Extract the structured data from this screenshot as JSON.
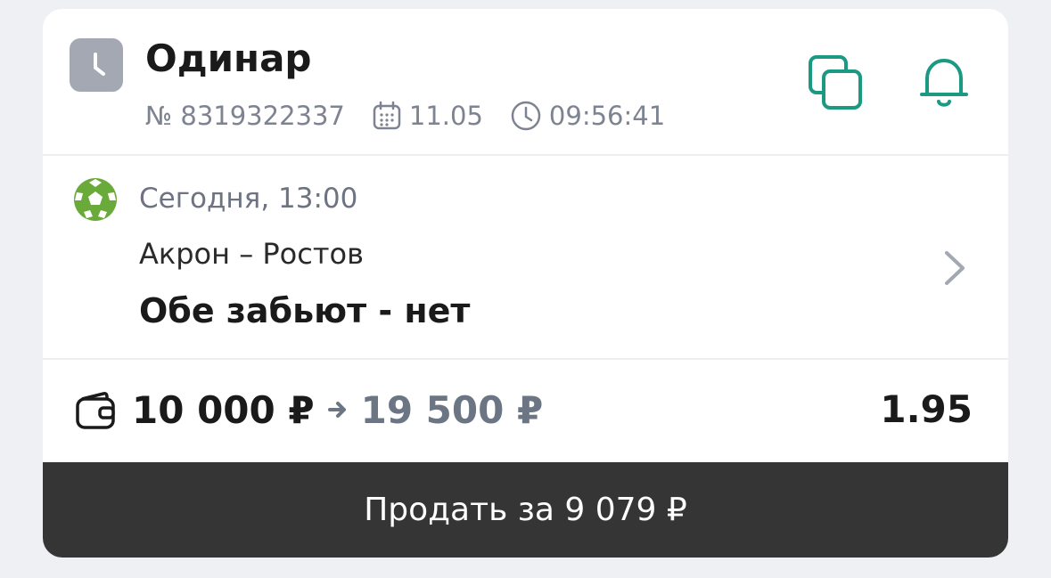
{
  "bet": {
    "type_label": "Одинар",
    "number": "№ 8319322337",
    "date": "11.05",
    "time": "09:56:41"
  },
  "event": {
    "sport_icon": "soccer-ball-icon",
    "start": "Сегодня, 13:00",
    "teams": "Акрон – Ростов",
    "selection": "Обе забьют - нет"
  },
  "amounts": {
    "stake": "10 000 ₽",
    "potential_win": "19 500 ₽",
    "odds": "1.95"
  },
  "actions": {
    "sell_label": "Продать за 9 079 ₽"
  },
  "colors": {
    "accent": "#1a9a83",
    "status_gray": "#a3a8b3",
    "sport_green": "#6aaa3a",
    "button_dark": "#353535"
  }
}
